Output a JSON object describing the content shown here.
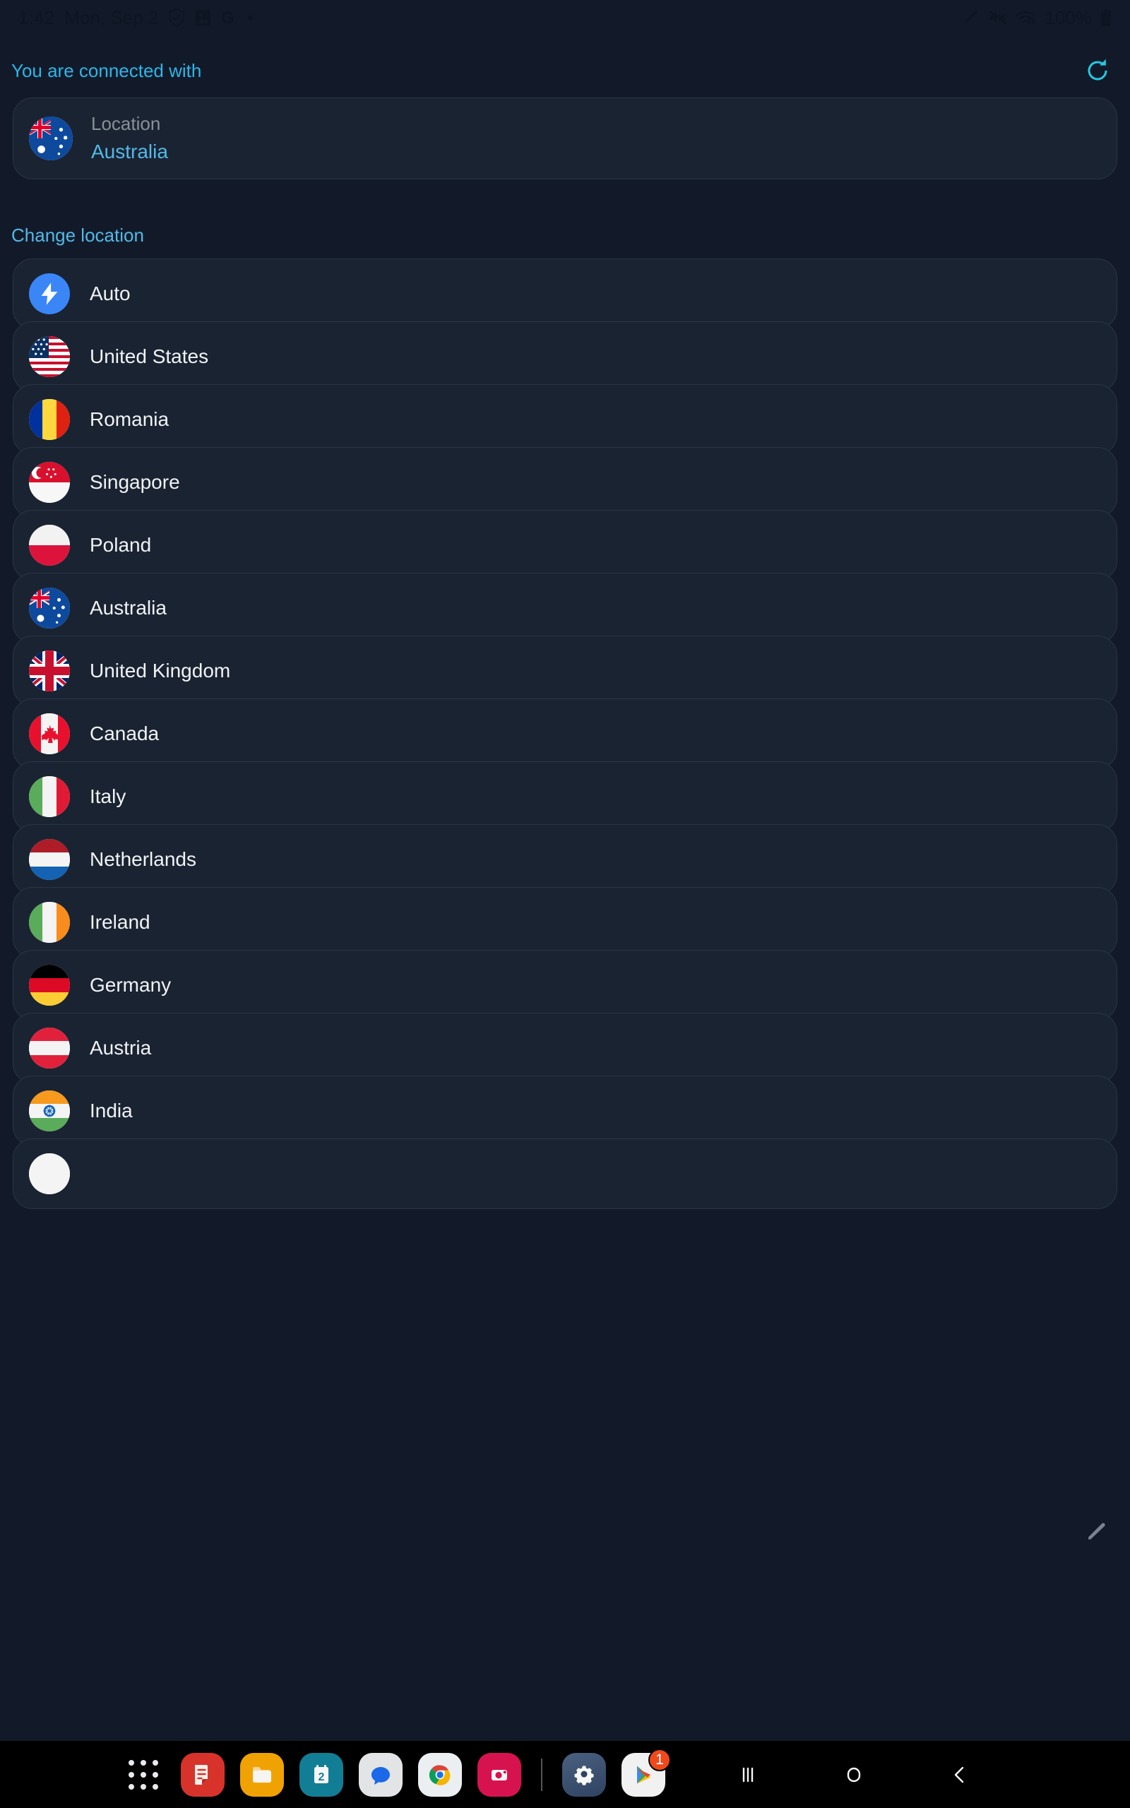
{
  "statusbar": {
    "time": "1:42",
    "date": "Mon, Sep 2",
    "battery_percent": "100%",
    "icons": [
      "shield-check-icon",
      "photo-icon",
      "google-g-icon",
      "dot-icon"
    ],
    "right_icons": [
      "pencil-icon",
      "volume-mute-icon",
      "wifi-icon",
      "battery-icon"
    ]
  },
  "header": {
    "title": "You are connected with",
    "refresh_icon": "refresh-icon",
    "accent_color": "#2cb6e8"
  },
  "status_card": {
    "flag": "australia",
    "label": "Location",
    "value": "Australia"
  },
  "section": {
    "label": "Change location"
  },
  "locations": [
    {
      "label": "Auto",
      "flag": "auto"
    },
    {
      "label": "United States",
      "flag": "united-states"
    },
    {
      "label": "Romania",
      "flag": "romania"
    },
    {
      "label": "Singapore",
      "flag": "singapore"
    },
    {
      "label": "Poland",
      "flag": "poland"
    },
    {
      "label": "Australia",
      "flag": "australia"
    },
    {
      "label": "United Kingdom",
      "flag": "united-kingdom"
    },
    {
      "label": "Canada",
      "flag": "canada"
    },
    {
      "label": "Italy",
      "flag": "italy"
    },
    {
      "label": "Netherlands",
      "flag": "netherlands"
    },
    {
      "label": "Ireland",
      "flag": "ireland"
    },
    {
      "label": "Germany",
      "flag": "germany"
    },
    {
      "label": "Austria",
      "flag": "austria"
    },
    {
      "label": "India",
      "flag": "india"
    },
    {
      "label": "",
      "flag": "partial"
    }
  ],
  "edge_handle": {
    "icon": "pencil-icon"
  },
  "taskbar": {
    "apps": [
      {
        "name": "apps-drawer",
        "label": "Apps"
      },
      {
        "name": "samsung-notes",
        "label": "Notes"
      },
      {
        "name": "my-files",
        "label": "My Files"
      },
      {
        "name": "calendar",
        "label": "Calendar",
        "day": "2"
      },
      {
        "name": "messages",
        "label": "Messages"
      },
      {
        "name": "chrome",
        "label": "Chrome"
      },
      {
        "name": "camera",
        "label": "Camera"
      },
      {
        "name": "settings",
        "label": "Settings"
      },
      {
        "name": "play-store",
        "label": "Play Store",
        "badge": "1"
      }
    ],
    "nav": [
      {
        "name": "recents-button",
        "glyph": "|||"
      },
      {
        "name": "home-button",
        "glyph": "○"
      },
      {
        "name": "back-button",
        "glyph": "‹"
      }
    ]
  },
  "colors": {
    "background": "#121a29",
    "card": "#1a2332",
    "card_border": "#2a3547",
    "accent": "#54b9e6",
    "refresh": "#27c9e0",
    "text": "#f1f3f5",
    "muted": "#8a9099"
  }
}
